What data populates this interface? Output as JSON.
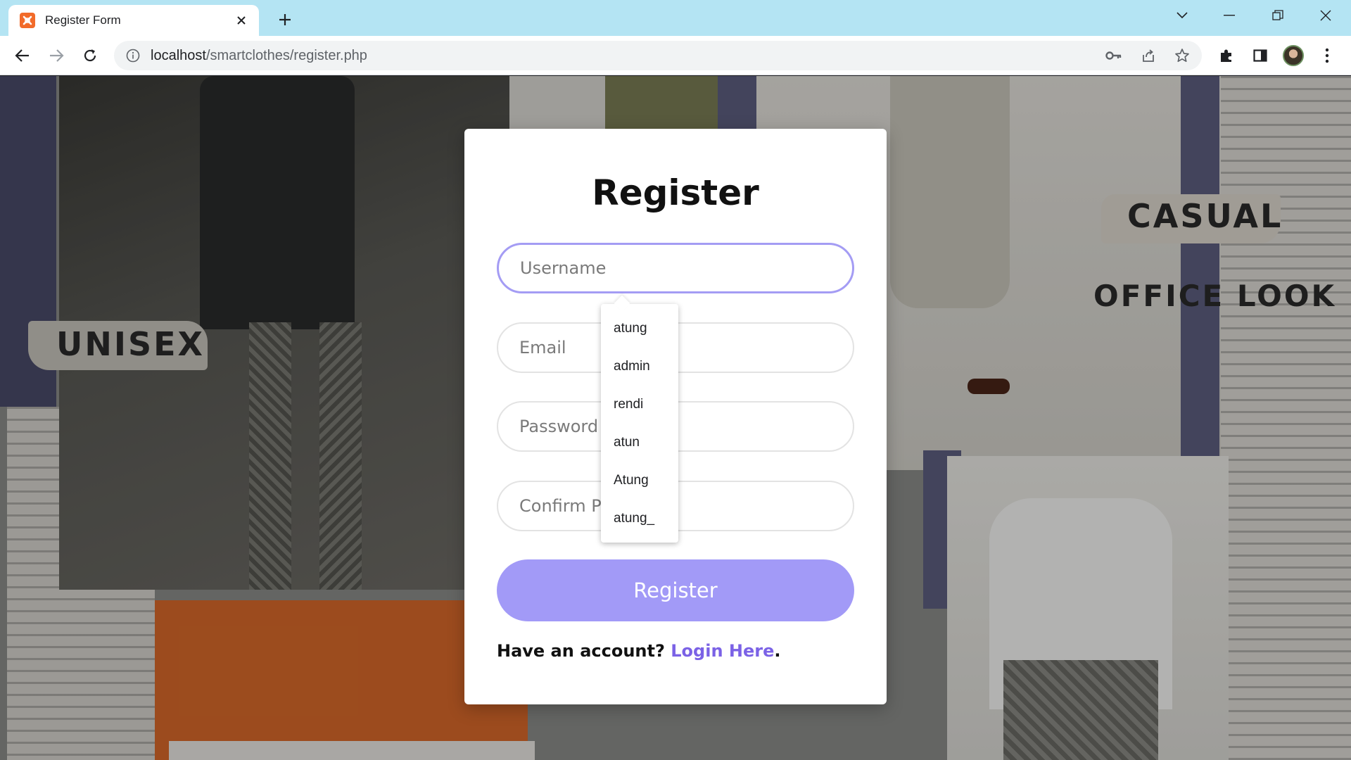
{
  "browser": {
    "tab_title": "Register Form",
    "url_host": "localhost",
    "url_path": "/smartclothes/register.php"
  },
  "background": {
    "labels": [
      "UNISEX",
      "CASUAL",
      "OFFICE LOOK"
    ]
  },
  "form": {
    "title": "Register",
    "username_placeholder": "Username",
    "email_placeholder": "Email",
    "password_placeholder": "Password",
    "confirm_placeholder": "Confirm Password",
    "submit_label": "Register",
    "account_prompt": "Have an account? ",
    "login_link": "Login Here",
    "account_suffix": "."
  },
  "autocomplete": {
    "items": [
      "atung",
      "admin",
      "rendi",
      "atun",
      "Atung",
      "atung_"
    ]
  },
  "colors": {
    "accent": "#a29af7",
    "link": "#7b62e6",
    "tabstrip": "#b4e4f3"
  }
}
